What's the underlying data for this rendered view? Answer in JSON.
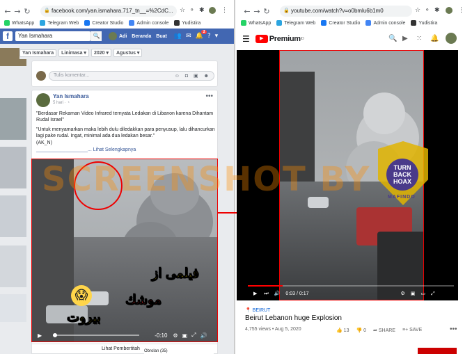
{
  "left_browser": {
    "url": "facebook.com/yan.ismahara.717_tn__=%2CdC...",
    "bookmarks": [
      {
        "label": "WhatsApp",
        "color": "#25d366"
      },
      {
        "label": "Telegram Web",
        "color": "#2ca5e0"
      },
      {
        "label": "Creator Studio",
        "color": "#1877f2"
      },
      {
        "label": "Admin console",
        "color": "#4285f4"
      },
      {
        "label": "Yudistira",
        "color": "#333333"
      }
    ]
  },
  "facebook": {
    "search_value": "Yan Ismahara",
    "search_icon_glyph": "🔍",
    "nav": {
      "user": "Adi",
      "home": "Beranda",
      "create": "Buat"
    },
    "notif_count": "2",
    "breadcrumbs": [
      "Yan Ismahara",
      "Linimasa ▾",
      "2020 ▾",
      "Agustus ▾"
    ],
    "comment_placeholder": "Tulis komentar...",
    "post": {
      "author": "Yan Ismahara",
      "time": "5 hari · ◔",
      "text1": "\"Berdasar Rekaman Video Infrared ternyata Ledakan di Libanon karena Dihantam Rudal Israel\"",
      "text2": "\"Untuk menyamarkan maka lebih dulu diledakkan para penyusup, lalu dihancurkan lagi pake rudal. Ingat, minimal ada dua ledakan besar.\"",
      "text3": "(AK_N)",
      "see_more": "___________________... Lihat Selengkapnya",
      "video_time": "-0:10",
      "arabic1": "فيلمى از",
      "arabic2": "موشك",
      "arabic3": "بيروت"
    },
    "bottom": {
      "more": "Lihat Pembertitah",
      "comments": "Obrolan (35)"
    }
  },
  "watermark": "SCREENSHOT BY",
  "right_browser": {
    "url": "youtube.com/watch?v=o0bmlu6b1m0",
    "bookmarks": [
      {
        "label": "WhatsApp",
        "color": "#25d366"
      },
      {
        "label": "Telegram Web",
        "color": "#2ca5e0"
      },
      {
        "label": "Creator Studio",
        "color": "#1877f2"
      },
      {
        "label": "Admin console",
        "color": "#4285f4"
      },
      {
        "label": "Yudistira",
        "color": "#333333"
      }
    ]
  },
  "youtube": {
    "brand": "Premium",
    "brand_sup": "ID",
    "time": "0:03 / 0:17",
    "tag": "📍 BEIRUT",
    "title": "Beirut Lebanon huge Explosion",
    "meta": "4,755 views • Aug 5, 2020",
    "likes": "13",
    "dislikes": "0",
    "share": "SHARE",
    "save": "SAVE",
    "mafindo": {
      "top": "TURN BACK HOAX",
      "bottom": "MAFINDO",
      "ring": "MASYARAKAT ANTI FITNAH INDONESIA"
    }
  }
}
